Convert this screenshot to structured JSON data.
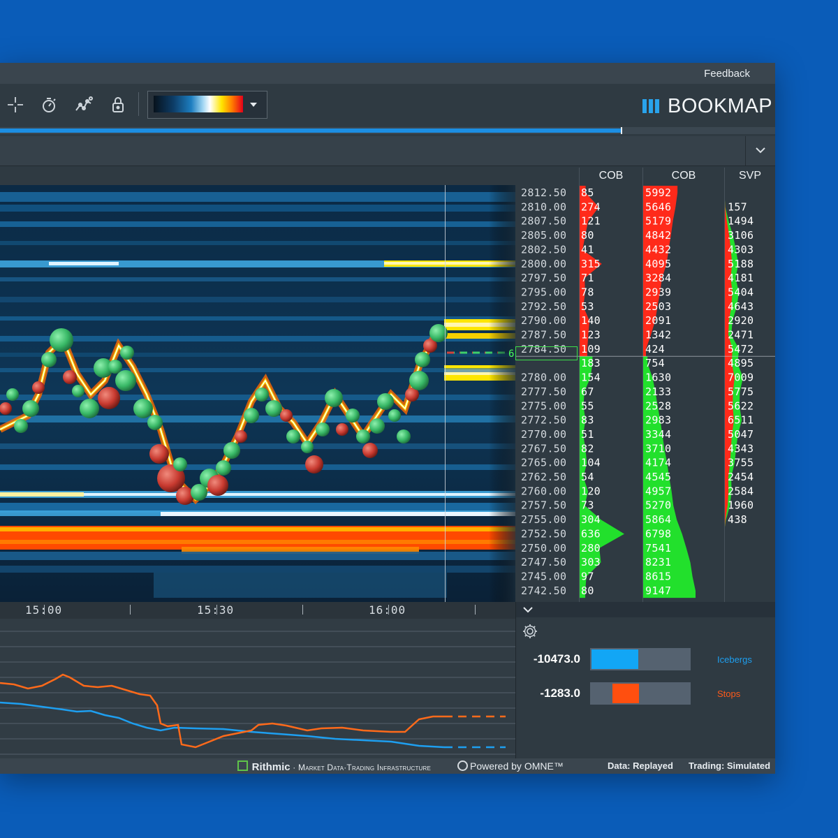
{
  "titlebar": {
    "feedback_label": "Feedback"
  },
  "toolbar": {
    "tools": [
      "crosshair-icon",
      "stopwatch-icon",
      "indicator-icon",
      "lock-icon"
    ],
    "heatmap_palette_dropdown": "heatmap-palette",
    "logo_text": "BOOKMAP"
  },
  "chart": {
    "time_labels": [
      "15:00",
      "15:30",
      "16:00"
    ],
    "current_price_tag": "6",
    "colors": {
      "heat_low": "#0d3c66",
      "heat_mid": "#1d7ec0",
      "heat_high": "#ffe600",
      "heat_max": "#ff4a00",
      "buy": "#3fcf6a",
      "sell": "#d2423a"
    }
  },
  "ladder": {
    "headers": [
      "COB",
      "COB",
      "SVP"
    ],
    "current_price": "2784.50",
    "rows": [
      {
        "price": "2812.50",
        "cob1": "85",
        "cob2": "5992",
        "svp": "",
        "side": "ask"
      },
      {
        "price": "2810.00",
        "cob1": "274",
        "cob2": "5646",
        "svp": "157",
        "side": "ask"
      },
      {
        "price": "2807.50",
        "cob1": "121",
        "cob2": "5179",
        "svp": "1494",
        "side": "ask"
      },
      {
        "price": "2805.00",
        "cob1": "80",
        "cob2": "4842",
        "svp": "3106",
        "side": "ask"
      },
      {
        "price": "2802.50",
        "cob1": "41",
        "cob2": "4432",
        "svp": "4303",
        "side": "ask"
      },
      {
        "price": "2800.00",
        "cob1": "315",
        "cob2": "4095",
        "svp": "5188",
        "side": "ask"
      },
      {
        "price": "2797.50",
        "cob1": "71",
        "cob2": "3284",
        "svp": "4181",
        "side": "ask"
      },
      {
        "price": "2795.00",
        "cob1": "78",
        "cob2": "2939",
        "svp": "5404",
        "side": "ask"
      },
      {
        "price": "2792.50",
        "cob1": "53",
        "cob2": "2503",
        "svp": "4643",
        "side": "ask"
      },
      {
        "price": "2790.00",
        "cob1": "140",
        "cob2": "2091",
        "svp": "2920",
        "side": "ask"
      },
      {
        "price": "2787.50",
        "cob1": "123",
        "cob2": "1342",
        "svp": "2471",
        "side": "ask"
      },
      {
        "price": "2784.50",
        "cob1": "109",
        "cob2": "424",
        "svp": "5472",
        "side": "ask"
      },
      {
        "price": "",
        "cob1": "183",
        "cob2": "754",
        "svp": "4895",
        "side": "bid"
      },
      {
        "price": "2780.00",
        "cob1": "154",
        "cob2": "1630",
        "svp": "7009",
        "side": "bid"
      },
      {
        "price": "2777.50",
        "cob1": "67",
        "cob2": "2133",
        "svp": "5775",
        "side": "bid"
      },
      {
        "price": "2775.00",
        "cob1": "55",
        "cob2": "2528",
        "svp": "5622",
        "side": "bid"
      },
      {
        "price": "2772.50",
        "cob1": "83",
        "cob2": "2983",
        "svp": "6511",
        "side": "bid"
      },
      {
        "price": "2770.00",
        "cob1": "51",
        "cob2": "3344",
        "svp": "5047",
        "side": "bid"
      },
      {
        "price": "2767.50",
        "cob1": "82",
        "cob2": "3710",
        "svp": "4343",
        "side": "bid"
      },
      {
        "price": "2765.00",
        "cob1": "104",
        "cob2": "4174",
        "svp": "3755",
        "side": "bid"
      },
      {
        "price": "2762.50",
        "cob1": "54",
        "cob2": "4545",
        "svp": "2454",
        "side": "bid"
      },
      {
        "price": "2760.00",
        "cob1": "120",
        "cob2": "4957",
        "svp": "2584",
        "side": "bid"
      },
      {
        "price": "2757.50",
        "cob1": "73",
        "cob2": "5270",
        "svp": "1960",
        "side": "bid"
      },
      {
        "price": "2755.00",
        "cob1": "304",
        "cob2": "5864",
        "svp": "438",
        "side": "bid"
      },
      {
        "price": "2752.50",
        "cob1": "636",
        "cob2": "6798",
        "svp": "",
        "side": "bid"
      },
      {
        "price": "2750.00",
        "cob1": "280",
        "cob2": "7541",
        "svp": "",
        "side": "bid"
      },
      {
        "price": "2747.50",
        "cob1": "303",
        "cob2": "8231",
        "svp": "",
        "side": "bid"
      },
      {
        "price": "2745.00",
        "cob1": "97",
        "cob2": "8615",
        "svp": "",
        "side": "bid"
      },
      {
        "price": "2742.50",
        "cob1": "80",
        "cob2": "9147",
        "svp": "",
        "side": "bid"
      }
    ]
  },
  "meters": {
    "icebergs": {
      "value": "-10473.0",
      "label": "Icebergs",
      "color": "#12a6f5",
      "fill_fraction": 0.48
    },
    "stops": {
      "value": "-1283.0",
      "label": "Stops",
      "color": "#ff4f0f",
      "fill_fraction": 0.27
    }
  },
  "statusbar": {
    "rithmic_brand": "Rithmic",
    "rithmic_tagline": "· Market Data·Trading Infrastructure",
    "omne": "Powered by OMNE™",
    "data_status": "Data: Replayed",
    "trading_status": "Trading: Simulated"
  }
}
